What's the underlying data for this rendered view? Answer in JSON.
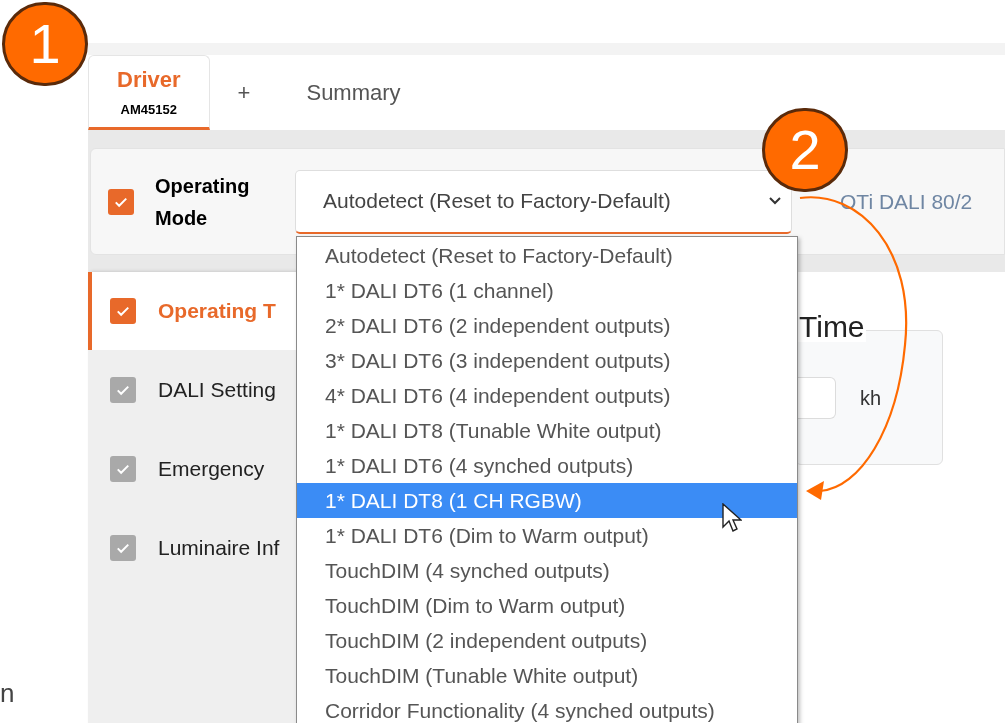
{
  "annotations": [
    {
      "label": "1"
    },
    {
      "label": "2"
    }
  ],
  "tabs": [
    {
      "label": "Driver",
      "sublabel": "AM45152",
      "selected": true
    },
    {
      "label": "+",
      "selected": false
    },
    {
      "label": "Summary",
      "selected": false
    }
  ],
  "operating_mode": {
    "checked": true,
    "label": "Operating Mode",
    "value": "Autodetect (Reset to Factory-Default)",
    "device": "OTi DALI 80/2"
  },
  "dropdown": {
    "options": [
      {
        "label": "Autodetect (Reset to Factory-Default)",
        "selected": false
      },
      {
        "label": "1* DALI DT6 (1 channel)",
        "selected": false
      },
      {
        "label": "2* DALI DT6 (2 independent outputs)",
        "selected": false
      },
      {
        "label": "3* DALI DT6 (3 independent outputs)",
        "selected": false
      },
      {
        "label": "4* DALI DT6 (4 independent outputs)",
        "selected": false
      },
      {
        "label": "1* DALI DT8 (Tunable White output)",
        "selected": false
      },
      {
        "label": "1* DALI DT6 (4 synched outputs)",
        "selected": false
      },
      {
        "label": "1* DALI DT8 (1 CH RGBW)",
        "selected": true
      },
      {
        "label": "1* DALI DT6 (Dim to Warm output)",
        "selected": false
      },
      {
        "label": "TouchDIM (4 synched outputs)",
        "selected": false
      },
      {
        "label": "TouchDIM (Dim to Warm output)",
        "selected": false
      },
      {
        "label": "TouchDIM (2 independent outputs)",
        "selected": false
      },
      {
        "label": "TouchDIM (Tunable White output)",
        "selected": false
      },
      {
        "label": "Corridor Functionality (4 synched outputs)",
        "selected": false
      }
    ]
  },
  "sidebar": {
    "items": [
      {
        "label": "Operating T",
        "checked": true,
        "selected": true
      },
      {
        "label": "DALI Setting",
        "checked": true,
        "selected": false
      },
      {
        "label": "Emergency",
        "checked": true,
        "selected": false
      },
      {
        "label": "Luminaire Inf",
        "checked": true,
        "selected": false
      }
    ]
  },
  "section": {
    "title": "Time",
    "unit": "kh"
  },
  "edge_text": "n"
}
